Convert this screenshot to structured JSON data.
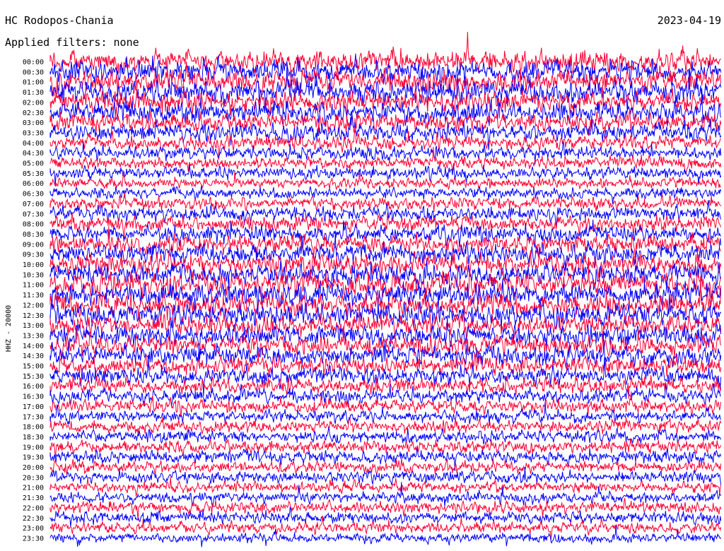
{
  "header": {
    "title": "HC Rodopos-Chania",
    "subtitle": "Applied filters: none",
    "date": "2023-04-19"
  },
  "chart_data": {
    "type": "line",
    "title": "HC Rodopos-Chania",
    "ylabel": "HHZ - 20000",
    "date": "2023-04-19",
    "rows": [
      "00:00",
      "00:30",
      "01:00",
      "01:30",
      "02:00",
      "02:30",
      "03:00",
      "03:30",
      "04:00",
      "04:30",
      "05:00",
      "05:30",
      "06:00",
      "06:30",
      "07:00",
      "07:30",
      "08:00",
      "08:30",
      "09:00",
      "09:30",
      "10:00",
      "10:30",
      "11:00",
      "11:30",
      "12:00",
      "12:30",
      "13:00",
      "13:30",
      "14:00",
      "14:30",
      "15:00",
      "15:30",
      "16:00",
      "16:30",
      "17:00",
      "17:30",
      "18:00",
      "18:30",
      "19:00",
      "19:30",
      "20:00",
      "20:30",
      "21:00",
      "21:30",
      "22:00",
      "22:30",
      "23:00",
      "23:30"
    ],
    "series": [
      {
        "name": "",
        "color": "#ff0033",
        "rows": "even"
      },
      {
        "name": "",
        "color": "#0000ff",
        "rows": "odd"
      }
    ],
    "trace_colors": [
      "#ff0033",
      "#0000ff"
    ],
    "row_minutes": 30,
    "noise_level": [
      0.95,
      0.95,
      0.95,
      0.95,
      0.9,
      0.9,
      0.8,
      0.7,
      0.6,
      0.55,
      0.5,
      0.5,
      0.45,
      0.45,
      0.55,
      0.6,
      0.65,
      0.7,
      0.75,
      0.8,
      0.85,
      0.9,
      0.95,
      0.95,
      0.9,
      0.9,
      0.85,
      0.85,
      0.8,
      0.8,
      0.75,
      0.7,
      0.65,
      0.6,
      0.55,
      0.5,
      0.5,
      0.5,
      0.55,
      0.55,
      0.5,
      0.5,
      0.45,
      0.45,
      0.5,
      0.5,
      0.45,
      0.4
    ],
    "grid": false
  }
}
